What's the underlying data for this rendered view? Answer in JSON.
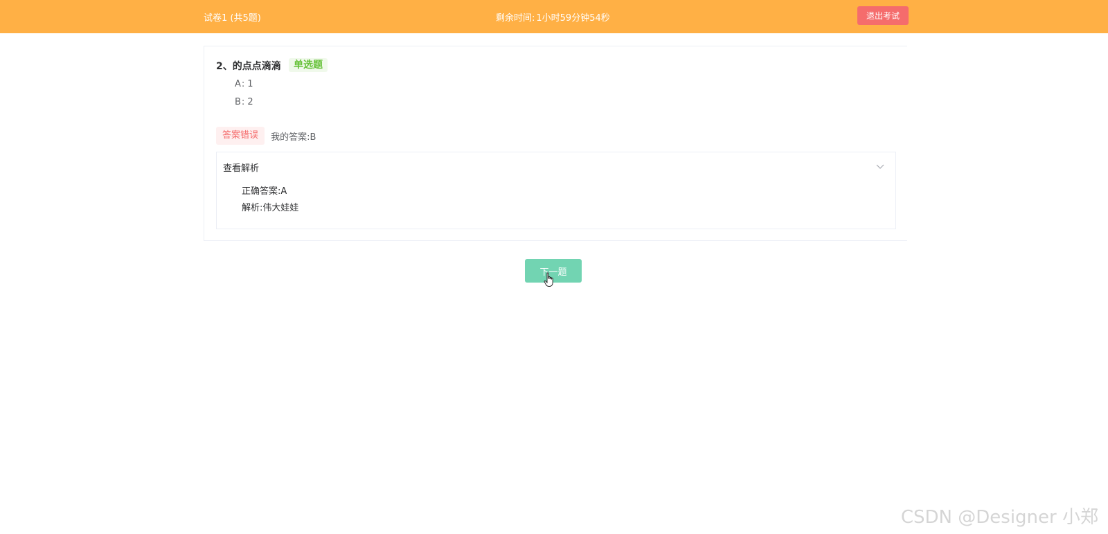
{
  "header": {
    "paper_title": "试卷1 (共5题)",
    "timer_label": "剩余时间:",
    "timer_value": "1小时59分钟54秒",
    "exit_label": "退出考试"
  },
  "question": {
    "number_title": "2、的点点滴滴",
    "type_tag": "单选题",
    "options": [
      {
        "key": "A",
        "value": "1"
      },
      {
        "key": "B",
        "value": "2"
      }
    ],
    "option_separator": ":",
    "result_tag": "答案错误",
    "my_answer": "我的答案:B"
  },
  "analysis": {
    "toggle_label": "查看解析",
    "correct_answer": "正确答案:A",
    "explanation": "解析:伟大娃娃"
  },
  "next_button": {
    "label": "下一题"
  },
  "watermark": "CSDN @Designer 小郑",
  "colors": {
    "header_bg": "#ffb045",
    "exit_button": "#f56c6c",
    "type_tag": "#67c23a",
    "wrong_tag": "#f56c6c",
    "next_button": "#72d4b2"
  },
  "icons": {
    "collapse": "chevron-down-icon",
    "pointer": "hand-pointer-cursor-icon"
  }
}
